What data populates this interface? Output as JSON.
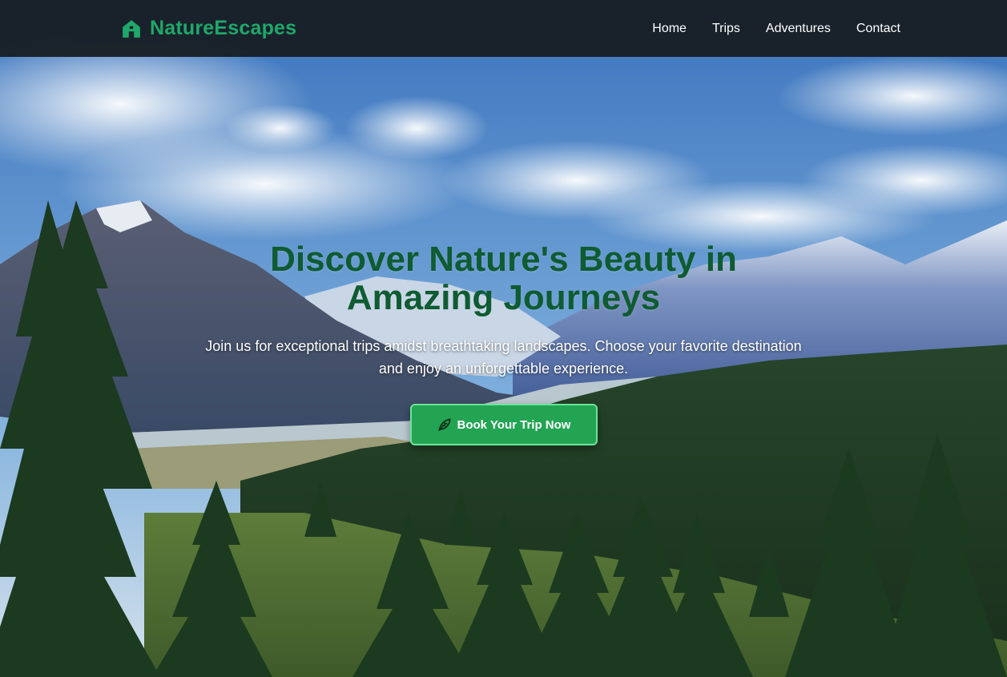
{
  "colors": {
    "brand": "#1fa86a",
    "nav_background": "#181e24",
    "hero_title": "#0f5b32",
    "cta_background": "#22a453",
    "cta_border": "#6ee39a"
  },
  "nav": {
    "brand_icon": "home-icon",
    "brand_name": "NatureEscapes",
    "links": [
      {
        "label": "Home"
      },
      {
        "label": "Trips"
      },
      {
        "label": "Adventures"
      },
      {
        "label": "Contact"
      }
    ]
  },
  "hero": {
    "title": "Discover Nature's Beauty in Amazing Journeys",
    "subtitle": "Join us for exceptional trips amidst breathtaking landscapes. Choose your favorite destination and enjoy an unforgettable experience.",
    "cta": {
      "icon": "leaf-icon",
      "label": "Book Your Trip Now"
    },
    "background": "mountain-forest-landscape"
  }
}
